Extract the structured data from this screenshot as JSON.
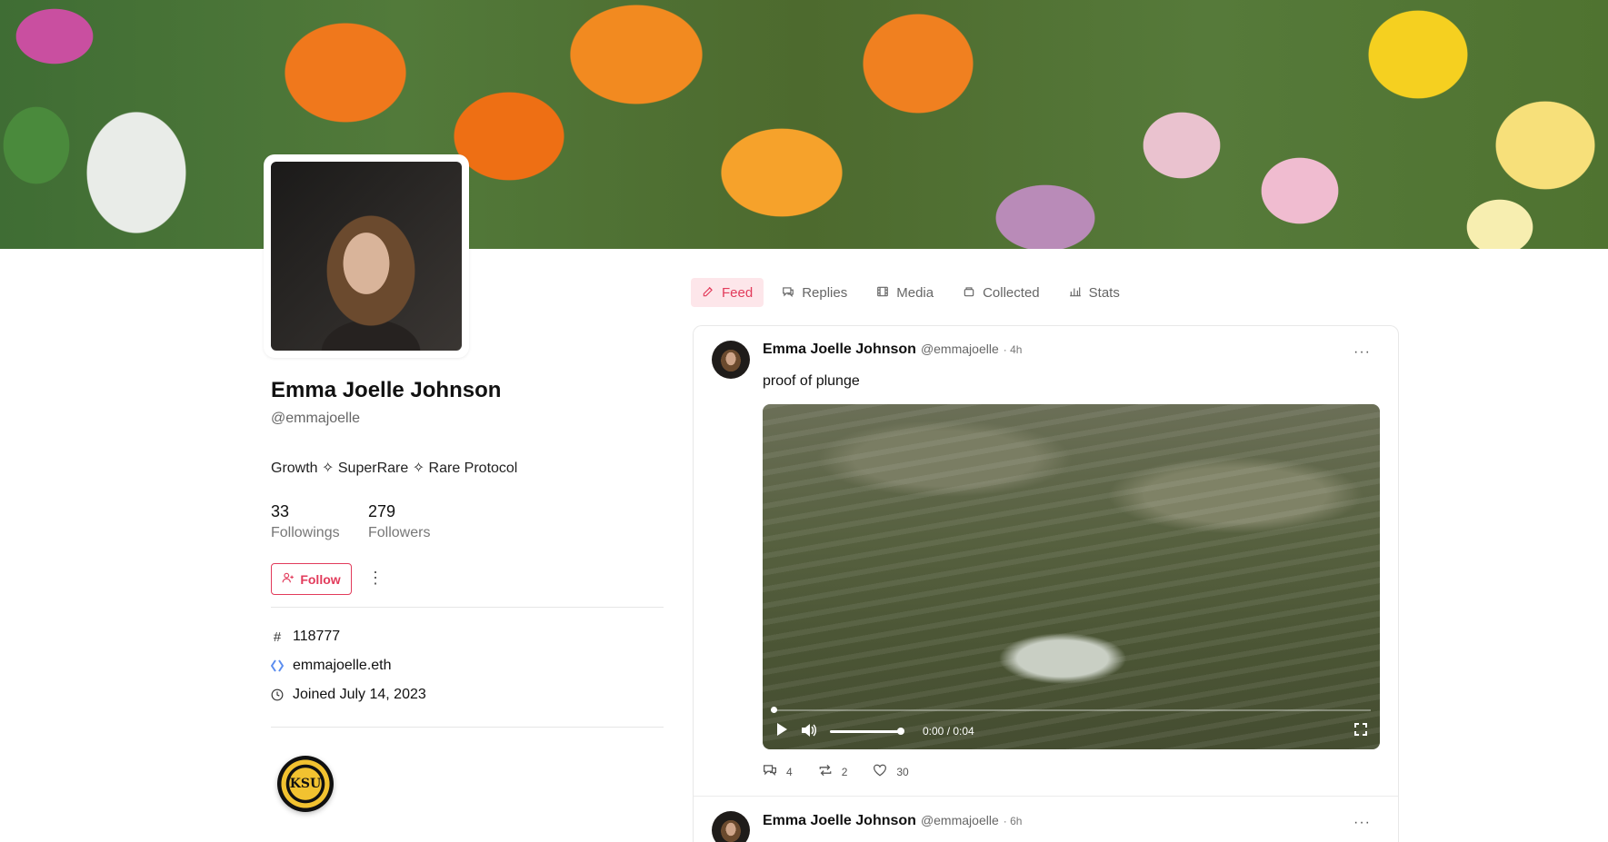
{
  "profile": {
    "name": "Emma Joelle Johnson",
    "handle": "@emmajoelle",
    "bio": "Growth ✧ SuperRare ✧ Rare Protocol",
    "followings_count": "33",
    "followings_label": "Followings",
    "followers_count": "279",
    "followers_label": "Followers",
    "follow_label": "Follow",
    "more_icon": "⋮",
    "fid": "118777",
    "ens": "emmajoelle.eth",
    "joined": "Joined July 14, 2023",
    "badge_text": "KSU"
  },
  "tabs": [
    {
      "label": "Feed",
      "icon": "edit-icon",
      "active": true
    },
    {
      "label": "Replies",
      "icon": "chat-icon",
      "active": false
    },
    {
      "label": "Media",
      "icon": "film-icon",
      "active": false
    },
    {
      "label": "Collected",
      "icon": "box-icon",
      "active": false
    },
    {
      "label": "Stats",
      "icon": "bar-chart-icon",
      "active": false
    }
  ],
  "posts": [
    {
      "author": "Emma Joelle Johnson",
      "handle": "@emmajoelle",
      "time": "· 4h",
      "text": "proof of plunge",
      "video_time": "0:00 / 0:04",
      "video_progress": 0.0,
      "volume_level": 1.0,
      "replies": "4",
      "recasts": "2",
      "likes": "30"
    },
    {
      "author": "Emma Joelle Johnson",
      "handle": "@emmajoelle",
      "time": "· 6h"
    }
  ],
  "colors": {
    "accent": "#e23b5b",
    "accent_bg": "#fde6ea"
  }
}
